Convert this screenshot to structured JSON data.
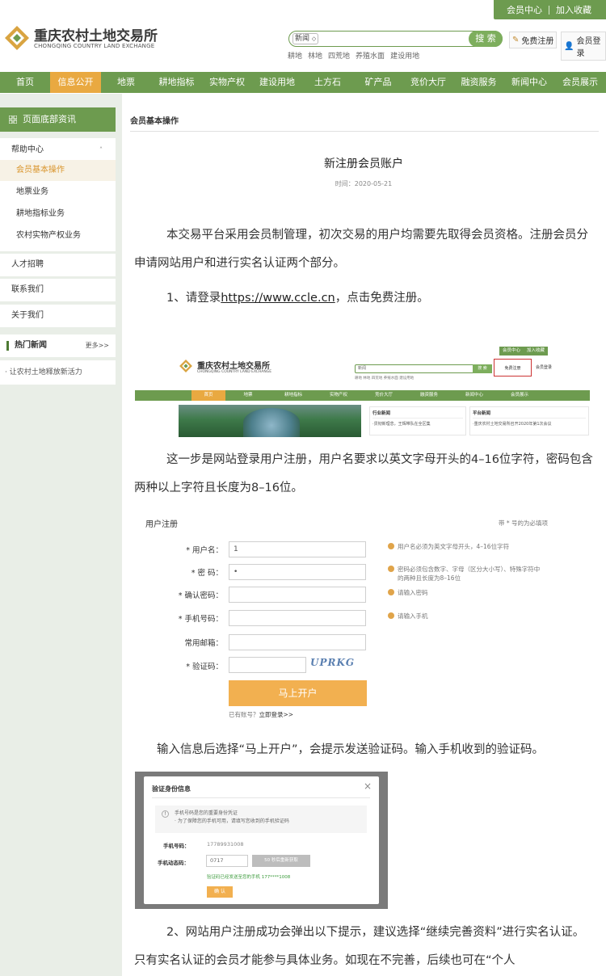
{
  "header": {
    "member_center": "会员中心",
    "add_favorite": "加入收藏",
    "logo_cn": "重庆农村土地交易所",
    "logo_en": "CHONGQING COUNTRY LAND EXCHANGE",
    "search_type": "新闻",
    "search_button": "搜 索",
    "quick_links": [
      "耕地",
      "林地",
      "四荒地",
      "养殖水面",
      "建设用地"
    ],
    "register": "免费注册",
    "login": "会员登录"
  },
  "nav": {
    "items": [
      "首页",
      "信息公开",
      "地票",
      "耕地指标",
      "实物产权",
      "建设用地",
      "土方石",
      "矿产品",
      "竞价大厅",
      "融资服务",
      "新闻中心",
      "会员展示"
    ],
    "active_index": 1
  },
  "sidebar": {
    "title": "页面底部资讯",
    "help_center": "帮助中心",
    "help_items": [
      "会员基本操作",
      "地票业务",
      "耕地指标业务",
      "农村实物产权业务"
    ],
    "active_help": 0,
    "other_items": [
      "人才招聘",
      "联系我们",
      "关于我们"
    ],
    "hot_news_title": "热门新闻",
    "more": "更多>>",
    "news_items": [
      "让农村土地释放新活力"
    ]
  },
  "article": {
    "breadcrumb": "会员基本操作",
    "title": "新注册会员账户",
    "time": "时间：2020-05-21",
    "p1": "本交易平台采用会员制管理，初次交易的用户均需要先取得会员资格。注册会员分申请网站用户和进行实名认证两个部分。",
    "p2_prefix": "1、请登录",
    "p2_link": "https://www.ccle.cn",
    "p2_suffix": "，点击免费注册。",
    "p3": "这一步是网站登录用户注册，用户名要求以英文字母开头的4–16位字符，密码包含两种以上字符且长度为8–16位。",
    "p4": "输入信息后选择“马上开户”，会提示发送验证码。输入手机收到的验证码。",
    "p5": "2、网站用户注册成功会弹出以下提示，建议选择“继续完善资料”进行实名认证。只有实名认证的会员才能参与具体业务。如现在不完善，后续也可在“个人"
  },
  "screenshot1": {
    "member_center": "会员中心",
    "add_favorite": "加入收藏",
    "logo_cn": "重庆农村土地交易所",
    "logo_en": "CHONGQING COUNTRY LAND EXCHANGE",
    "search_type": "新闻",
    "search_button": "搜 索",
    "register": "免费注册",
    "login": "会员登录",
    "quick_links": "耕地 林地 四荒地 养殖水面 建设用地",
    "nav": [
      "首页",
      "地票",
      "耕地指标",
      "实物产权",
      "竞价大厅",
      "融资服务",
      "新闻中心",
      "会员展示"
    ],
    "panel1_title": "行业新闻",
    "panel1_text": "·贯彻新理念，王辉带队在全区集",
    "panel2_title": "平台新闻",
    "panel2_text": "·重庆农村土地交易所召开2020年第1次会议"
  },
  "screenshot2": {
    "title": "用户注册",
    "required_note": "带 * 号的为必填项",
    "fields": [
      {
        "label": "* 用户名：",
        "value": "1",
        "hint": "用户名必须为英文字母开头，4–16位字符"
      },
      {
        "label": "* 密 码：",
        "value": "•",
        "hint": "密码必须包含数字、字母（区分大小写）、特殊字符中的两种且长度为8–16位"
      },
      {
        "label": "* 确认密码：",
        "value": "",
        "hint": "请输入密码"
      },
      {
        "label": "* 手机号码：",
        "value": "",
        "hint": "请输入手机"
      },
      {
        "label": "常用邮箱：",
        "value": "",
        "hint": ""
      },
      {
        "label": "* 验证码：",
        "value": "",
        "hint": ""
      }
    ],
    "captcha": "UPRKG",
    "submit": "马上开户",
    "login_prefix": "已有账号？",
    "login_link": "立即登录>>"
  },
  "screenshot3": {
    "title": "验证身份信息",
    "notice_line1": "手机号码是您的重要身份凭证",
    "notice_line2": "· 为了保障您的手机可用，请填写您收到的手机验证码",
    "phone_label": "手机号码：",
    "phone_value": "17789931008",
    "code_label": "手机动态码：",
    "code_value": "0717",
    "resend_button": "50 秒后重新获取",
    "sent_note": "验证码已经发送至您的手机 177****1008",
    "confirm_button": "确 认"
  },
  "colors": {
    "brand_green": "#6d9b4f",
    "active_orange": "#e9a941",
    "sidebar_bg": "#e9eee7"
  }
}
